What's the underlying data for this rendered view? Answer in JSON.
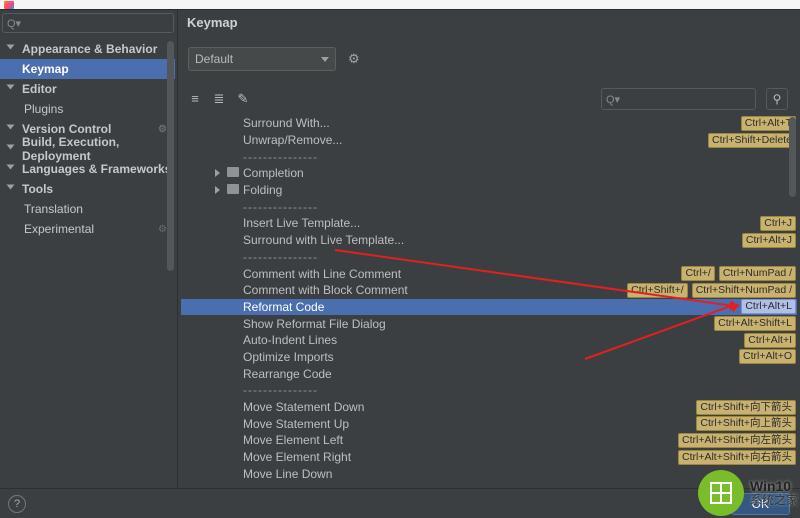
{
  "page": {
    "title": "Keymap"
  },
  "profile": {
    "value": "Default"
  },
  "sidebar": {
    "items": [
      {
        "label": "Appearance & Behavior",
        "expandable": true
      },
      {
        "label": "Keymap",
        "selected": true
      },
      {
        "label": "Editor",
        "expandable": true
      },
      {
        "label": "Plugins",
        "sub": true
      },
      {
        "label": "Version Control",
        "expandable": true,
        "gear": true
      },
      {
        "label": "Build, Execution, Deployment",
        "expandable": true
      },
      {
        "label": "Languages & Frameworks",
        "expandable": true
      },
      {
        "label": "Tools",
        "expandable": true
      },
      {
        "label": "Translation",
        "sub": true
      },
      {
        "label": "Experimental",
        "sub": true,
        "gear": true
      }
    ]
  },
  "tree": [
    {
      "label": "Surround With...",
      "shortcuts": [
        "Ctrl+Alt+T"
      ]
    },
    {
      "label": "Unwrap/Remove...",
      "shortcuts": [
        "Ctrl+Shift+Delete"
      ]
    },
    {
      "label": "---------------",
      "dash": true
    },
    {
      "label": "Completion",
      "folder": true
    },
    {
      "label": "Folding",
      "folder": true
    },
    {
      "label": "---------------",
      "dash": true
    },
    {
      "label": "Insert Live Template...",
      "shortcuts": [
        "Ctrl+J"
      ]
    },
    {
      "label": "Surround with Live Template...",
      "shortcuts": [
        "Ctrl+Alt+J"
      ]
    },
    {
      "label": "---------------",
      "dash": true
    },
    {
      "label": "Comment with Line Comment",
      "shortcuts": [
        "Ctrl+/",
        "Ctrl+NumPad /"
      ]
    },
    {
      "label": "Comment with Block Comment",
      "shortcuts": [
        "Ctrl+Shift+/",
        "Ctrl+Shift+NumPad /"
      ]
    },
    {
      "label": "Reformat Code",
      "highlight": true,
      "shortcuts": [
        "Ctrl+Alt+L"
      ]
    },
    {
      "label": "Show Reformat File Dialog",
      "shortcuts": [
        "Ctrl+Alt+Shift+L"
      ]
    },
    {
      "label": "Auto-Indent Lines",
      "shortcuts": [
        "Ctrl+Alt+I"
      ]
    },
    {
      "label": "Optimize Imports",
      "shortcuts": [
        "Ctrl+Alt+O"
      ]
    },
    {
      "label": "Rearrange Code"
    },
    {
      "label": "---------------",
      "dash": true
    },
    {
      "label": "Move Statement Down",
      "shortcuts": [
        "Ctrl+Shift+向下箭头"
      ]
    },
    {
      "label": "Move Statement Up",
      "shortcuts": [
        "Ctrl+Shift+向上箭头"
      ]
    },
    {
      "label": "Move Element Left",
      "shortcuts": [
        "Ctrl+Alt+Shift+向左箭头"
      ]
    },
    {
      "label": "Move Element Right",
      "shortcuts": [
        "Ctrl+Alt+Shift+向右箭头"
      ]
    },
    {
      "label": "Move Line Down"
    }
  ],
  "icons": {
    "expand_all": "⇱",
    "collapse_all": "⇲",
    "edit": "✎",
    "search": "Q▾",
    "find_action": "⚲"
  },
  "buttons": {
    "ok": "OK",
    "help": "?"
  },
  "watermark": {
    "brand": "Win10",
    "site": "系统之家"
  }
}
